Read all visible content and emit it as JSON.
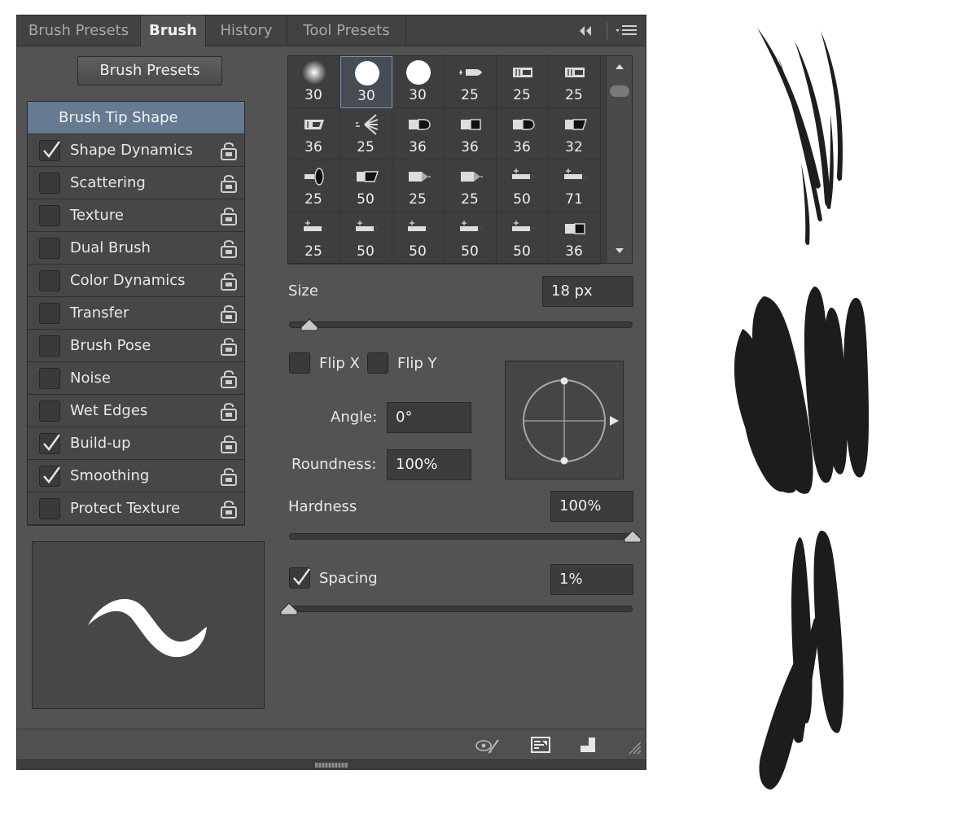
{
  "tabs": [
    {
      "label": "Brush Presets",
      "active": false
    },
    {
      "label": "Brush",
      "active": true
    },
    {
      "label": "History",
      "active": false
    },
    {
      "label": "Tool Presets",
      "active": false
    }
  ],
  "presets_button": "Brush Presets",
  "options": [
    {
      "label": "Brush Tip Shape",
      "selected": true
    },
    {
      "label": "Shape Dynamics",
      "checked": true
    },
    {
      "label": "Scattering",
      "checked": false
    },
    {
      "label": "Texture",
      "checked": false
    },
    {
      "label": "Dual Brush",
      "checked": false
    },
    {
      "label": "Color Dynamics",
      "checked": false
    },
    {
      "label": "Transfer",
      "checked": false
    },
    {
      "label": "Brush Pose",
      "checked": false
    },
    {
      "label": "Noise",
      "checked": false
    },
    {
      "label": "Wet Edges",
      "checked": false
    },
    {
      "label": "Build-up",
      "checked": true
    },
    {
      "label": "Smoothing",
      "checked": true
    },
    {
      "label": "Protect Texture",
      "checked": false
    }
  ],
  "tips": [
    {
      "size": "30",
      "icon": "soft-round"
    },
    {
      "size": "30",
      "icon": "hard-round"
    },
    {
      "size": "30",
      "icon": "hard-round"
    },
    {
      "size": "25",
      "icon": "bristle-brush"
    },
    {
      "size": "25",
      "icon": "flat-bristle"
    },
    {
      "size": "25",
      "icon": "flat-bristle"
    },
    {
      "size": "36",
      "icon": "angled-bristle"
    },
    {
      "size": "25",
      "icon": "fan-bristle"
    },
    {
      "size": "36",
      "icon": "round-tip"
    },
    {
      "size": "36",
      "icon": "flat-tip"
    },
    {
      "size": "36",
      "icon": "round-tip"
    },
    {
      "size": "32",
      "icon": "angled-tip"
    },
    {
      "size": "25",
      "icon": "round-erodible"
    },
    {
      "size": "50",
      "icon": "angled-tip"
    },
    {
      "size": "25",
      "icon": "point-erodible"
    },
    {
      "size": "25",
      "icon": "point-erodible"
    },
    {
      "size": "50",
      "icon": "pencil-tip"
    },
    {
      "size": "71",
      "icon": "pencil-tip"
    },
    {
      "size": "25",
      "icon": "pencil-tip"
    },
    {
      "size": "50",
      "icon": "pencil-tip"
    },
    {
      "size": "50",
      "icon": "pencil-tip"
    },
    {
      "size": "50",
      "icon": "pencil-tip"
    },
    {
      "size": "50",
      "icon": "pencil-tip"
    },
    {
      "size": "36",
      "icon": "flat-tip"
    }
  ],
  "size": {
    "label": "Size",
    "value": "18 px",
    "slider_fraction": 0.06
  },
  "flip_x": {
    "label": "Flip X",
    "checked": false
  },
  "flip_y": {
    "label": "Flip Y",
    "checked": false
  },
  "angle": {
    "label": "Angle:",
    "value": "0°"
  },
  "roundness": {
    "label": "Roundness:",
    "value": "100%"
  },
  "hardness": {
    "label": "Hardness",
    "value": "100%",
    "slider_fraction": 1.0
  },
  "spacing": {
    "label": "Spacing",
    "value": "1%",
    "checked": true,
    "slider_fraction": 0.0
  },
  "bottom_icons": [
    "brush-preview-eye-icon",
    "brush-settings-icon",
    "new-preset-icon"
  ],
  "colors": {
    "panel": "#535353",
    "tab_bar": "#424242",
    "selected_option": "#667a91",
    "stroke": "#1c1c1c"
  }
}
